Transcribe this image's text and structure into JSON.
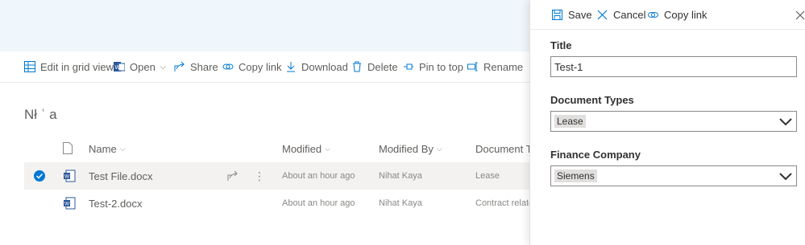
{
  "commandbar": {
    "edit_grid": "Edit in grid view",
    "open": "Open",
    "share": "Share",
    "copy_link": "Copy link",
    "download": "Download",
    "delete": "Delete",
    "pin": "Pin to top",
    "rename": "Rename"
  },
  "breadcrumb": {
    "title": "Nł ʾ a"
  },
  "columns": {
    "name": "Name",
    "modified": "Modified",
    "modified_by": "Modified By",
    "document_type": "Document Ty"
  },
  "files": [
    {
      "name": "Test File.docx",
      "modified": "About an hour ago",
      "modified_by": "Nihat Kaya",
      "doc_type": "Lease",
      "selected": true
    },
    {
      "name": "Test-2.docx",
      "modified": "About an hour ago",
      "modified_by": "Nihat Kaya",
      "doc_type": "Contract related",
      "selected": false
    }
  ],
  "panel": {
    "save": "Save",
    "cancel": "Cancel",
    "copy_link": "Copy link",
    "title_label": "Title",
    "title_value": "Test-1",
    "doc_types_label": "Document Types",
    "doc_types_value": "Lease",
    "finance_label": "Finance Company",
    "finance_value": "Siemens"
  },
  "colors": {
    "accent": "#0078d4",
    "word": "#2b579a"
  }
}
